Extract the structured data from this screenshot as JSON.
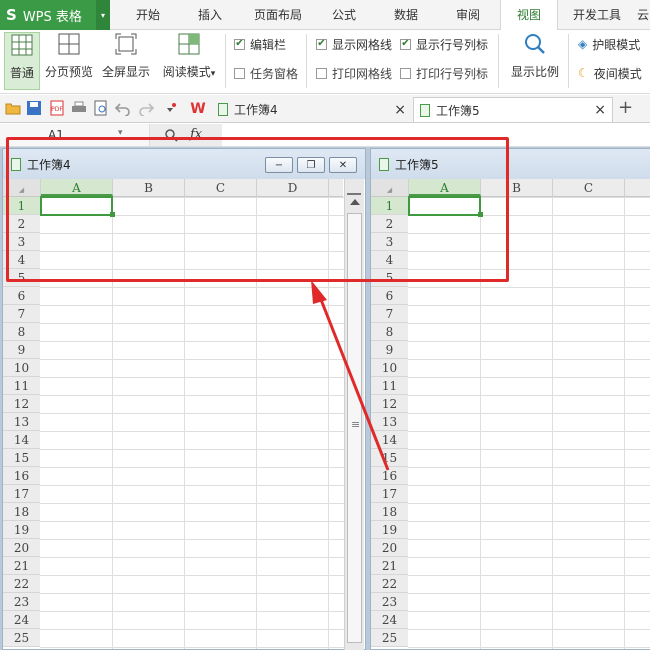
{
  "app": {
    "logo": "S",
    "title": "WPS 表格",
    "dropdown": "▾"
  },
  "menu": [
    "开始",
    "插入",
    "页面布局",
    "公式",
    "数据",
    "审阅",
    "视图",
    "开发工具",
    "云"
  ],
  "menu_active_index": 6,
  "ribbon": {
    "buttons": [
      "普通",
      "分页预览",
      "全屏显示",
      "阅读模式"
    ],
    "reading_dropdown": "▾",
    "checks_col1": [
      {
        "label": "编辑栏",
        "checked": true
      },
      {
        "label": "任务窗格",
        "checked": false
      }
    ],
    "checks_col2": [
      {
        "label": "显示网格线",
        "checked": true
      },
      {
        "label": "打印网格线",
        "checked": false
      }
    ],
    "checks_col3": [
      {
        "label": "显示行号列标",
        "checked": true
      },
      {
        "label": "打印行号列标",
        "checked": false
      }
    ],
    "zoom_label": "显示比例",
    "eye_mode": "护眼模式",
    "night_mode": "夜间模式"
  },
  "doc_tabs": [
    {
      "label": "工作簿4",
      "close": "×"
    },
    {
      "label": "工作簿5",
      "close": "×"
    }
  ],
  "new_tab": "+",
  "formula_bar": {
    "cell_ref": "A1",
    "dropdown": "▾",
    "fx": "fx"
  },
  "window_left": {
    "title": "工作簿4",
    "columns": [
      "A",
      "B",
      "C",
      "D"
    ],
    "rows": [
      "1",
      "2",
      "3",
      "4",
      "5",
      "6",
      "7",
      "8",
      "9",
      "10",
      "11",
      "12",
      "13",
      "14",
      "15",
      "16",
      "17",
      "18",
      "19",
      "20",
      "21",
      "22",
      "23",
      "24",
      "25"
    ],
    "buttons": {
      "minimize": "−",
      "restore": "❐",
      "close": "✕"
    },
    "scroll_grip": "≡"
  },
  "window_right": {
    "title": "工作簿5",
    "columns": [
      "A",
      "B",
      "C"
    ],
    "rows": [
      "1",
      "2",
      "3",
      "4",
      "5",
      "6",
      "7",
      "8",
      "9",
      "10",
      "11",
      "12",
      "13",
      "14",
      "15",
      "16",
      "17",
      "18",
      "19",
      "20",
      "21",
      "22",
      "23",
      "24",
      "25"
    ]
  },
  "colors": {
    "accent": "#3b9a46",
    "annotation": "#e02a2a"
  }
}
